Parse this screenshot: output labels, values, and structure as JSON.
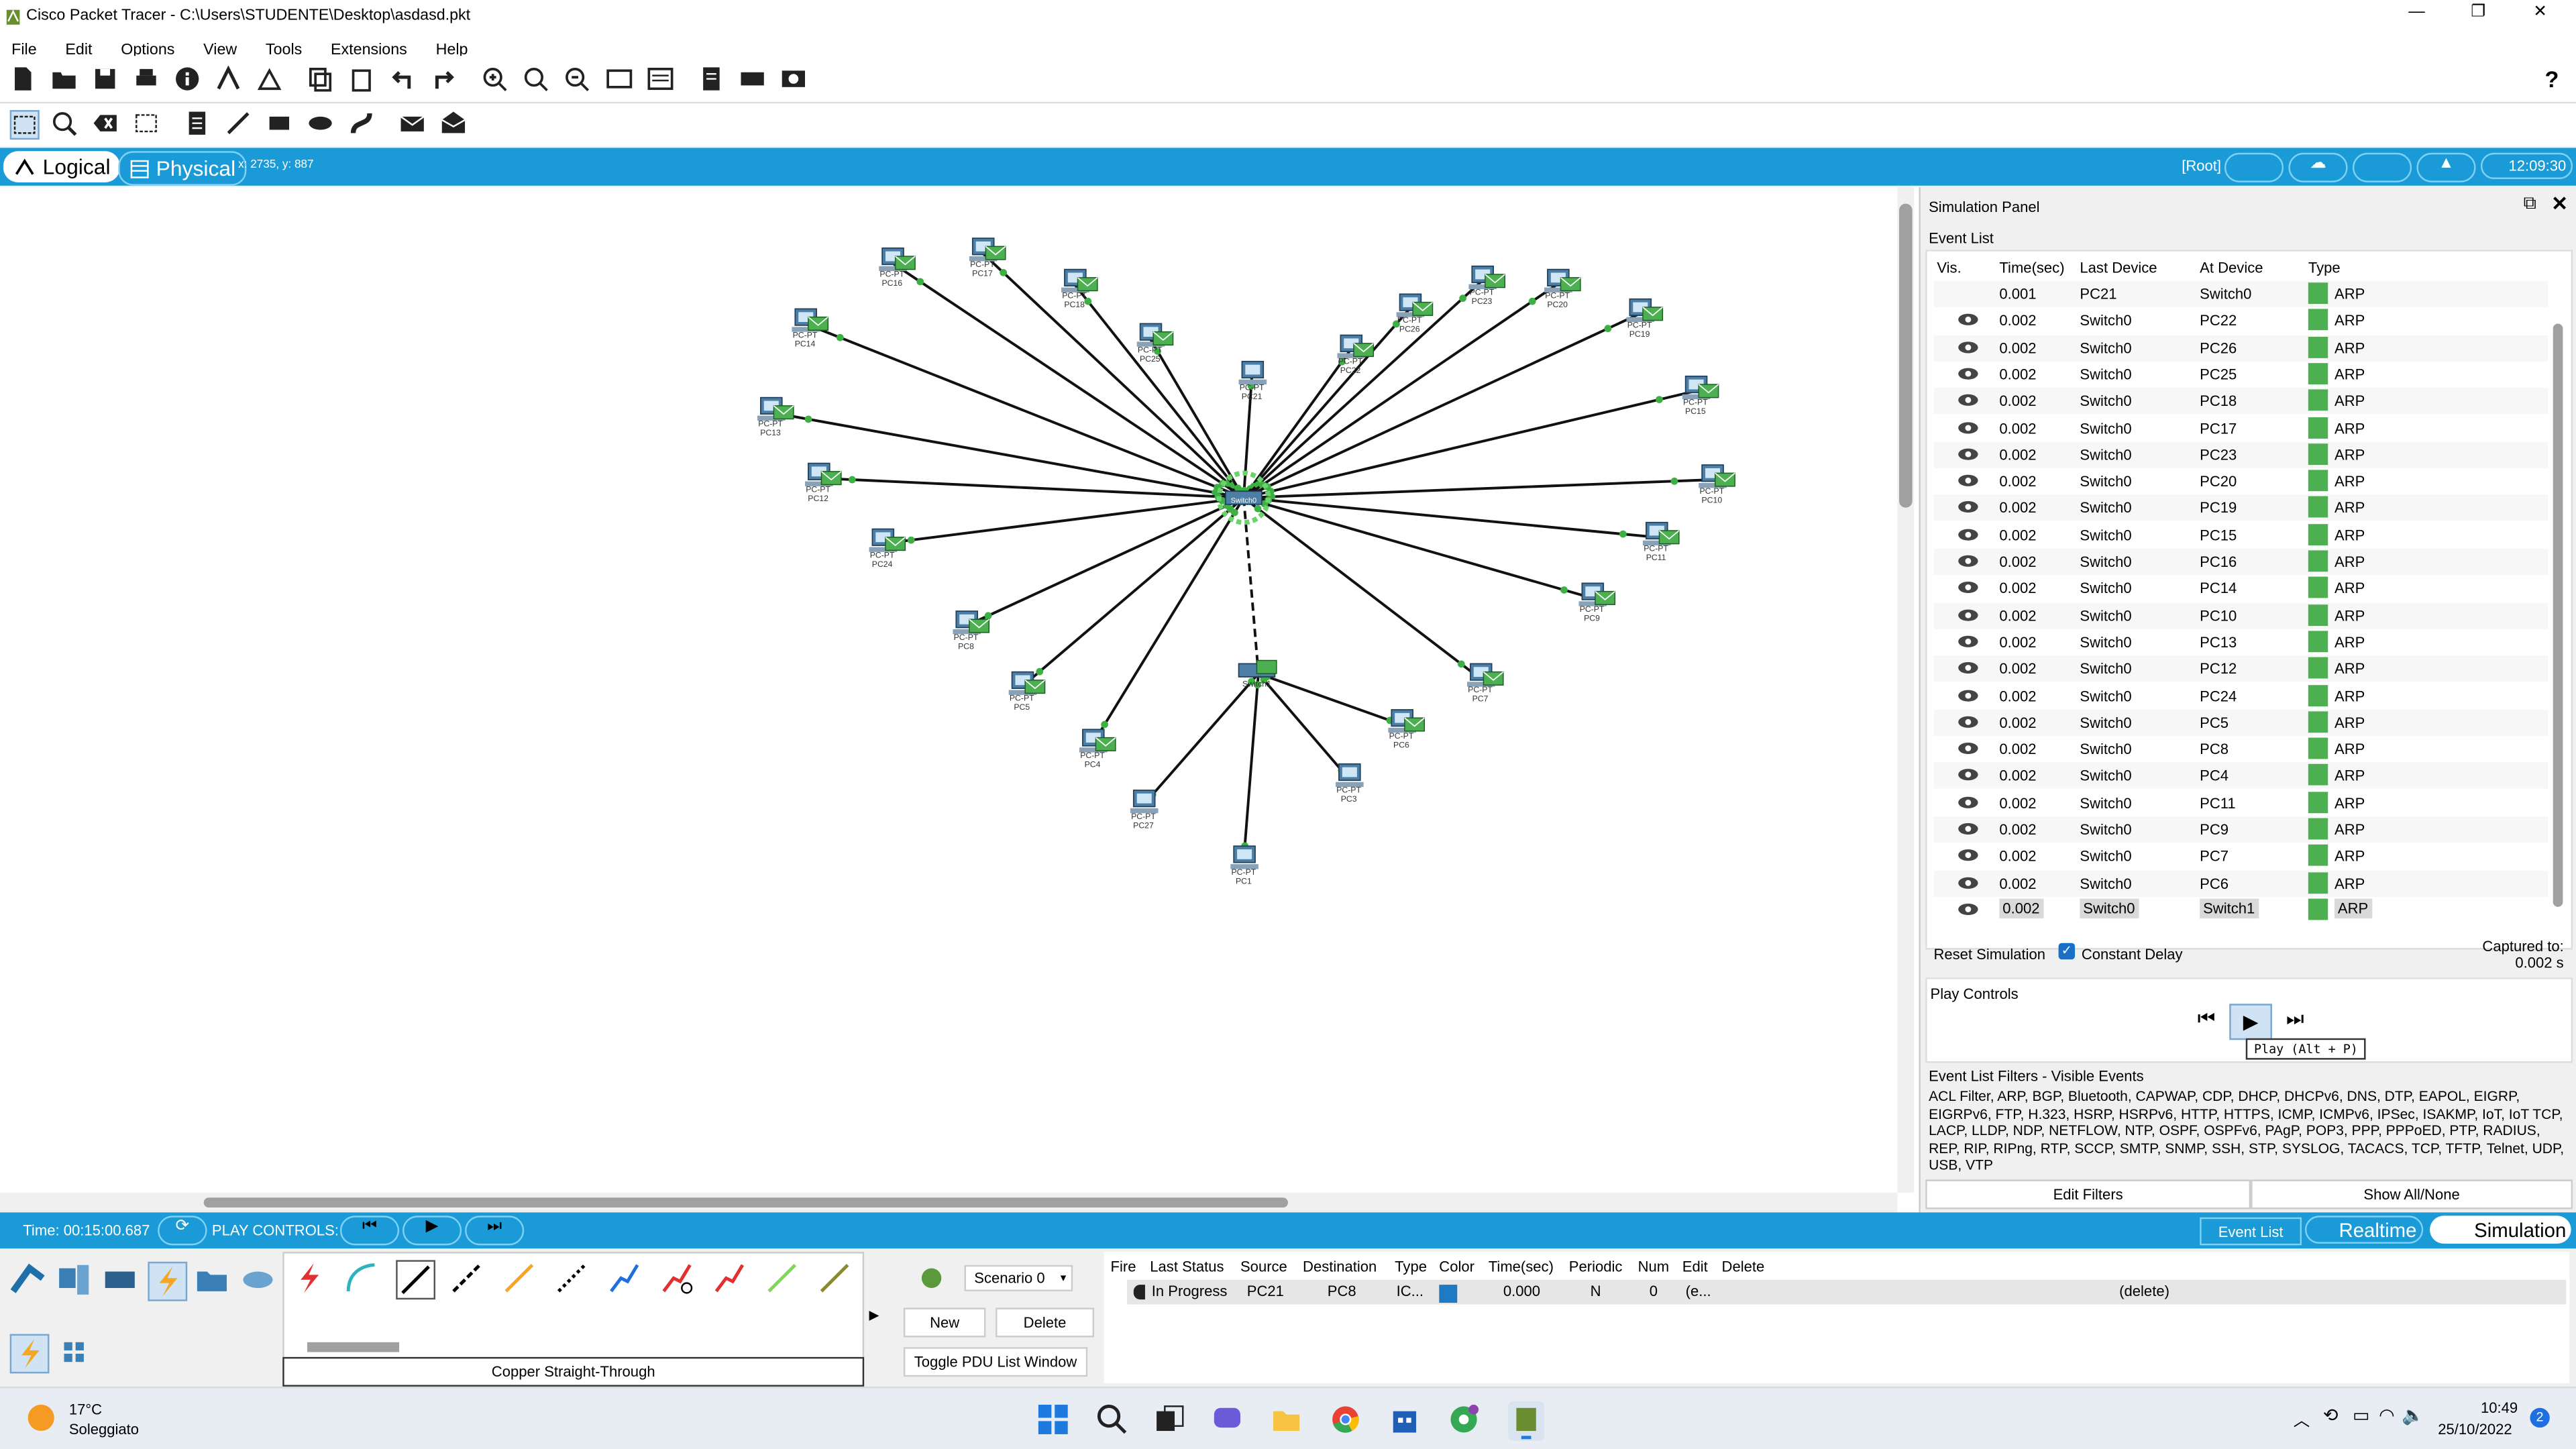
{
  "window": {
    "title": "Cisco Packet Tracer - C:\\Users\\STUDENTE\\Desktop\\asdasd.pkt",
    "controls": [
      "—",
      "❐",
      "✕"
    ]
  },
  "menu": [
    "File",
    "Edit",
    "Options",
    "View",
    "Tools",
    "Extensions",
    "Help"
  ],
  "help_icon": "?",
  "workspace": {
    "logical_label": "Logical",
    "physical_label": "Physical",
    "coords": "x: 2735, y: 887",
    "root_label": "[Root]",
    "clock": "12:09:30"
  },
  "topology": {
    "center": "Switch0",
    "devices": [
      {
        "name": "PC16",
        "model": "PC-PT"
      },
      {
        "name": "PC17",
        "model": "PC-PT"
      },
      {
        "name": "PC18",
        "model": "PC-PT"
      },
      {
        "name": "PC14",
        "model": "PC-PT"
      },
      {
        "name": "PC25",
        "model": "PC-PT"
      },
      {
        "name": "PC21",
        "model": "PC-PT"
      },
      {
        "name": "PC22",
        "model": "PC-PT"
      },
      {
        "name": "PC26",
        "model": "PC-PT"
      },
      {
        "name": "PC23",
        "model": "PC-PT"
      },
      {
        "name": "PC20",
        "model": "PC-PT"
      },
      {
        "name": "PC19",
        "model": "PC-PT"
      },
      {
        "name": "PC13",
        "model": "PC-PT"
      },
      {
        "name": "PC15",
        "model": "PC-PT"
      },
      {
        "name": "PC12",
        "model": "PC-PT"
      },
      {
        "name": "PC10",
        "model": "PC-PT"
      },
      {
        "name": "PC24",
        "model": "PC-PT"
      },
      {
        "name": "PC11",
        "model": "PC-PT"
      },
      {
        "name": "PC9",
        "model": "PC-PT"
      },
      {
        "name": "PC8",
        "model": "PC-PT"
      },
      {
        "name": "PC5",
        "model": "PC-PT"
      },
      {
        "name": "PC7",
        "model": "PC-PT"
      },
      {
        "name": "Switch1",
        "model": ""
      },
      {
        "name": "PC6",
        "model": "PC-PT"
      },
      {
        "name": "PC4",
        "model": "PC-PT"
      },
      {
        "name": "PC3",
        "model": "PC-PT"
      },
      {
        "name": "PC27",
        "model": "PC-PT"
      },
      {
        "name": "PC1",
        "model": "PC-PT"
      }
    ]
  },
  "sim_panel": {
    "title": "Simulation Panel",
    "event_list_label": "Event List",
    "headers": [
      "Vis.",
      "Time(sec)",
      "Last Device",
      "At Device",
      "Type"
    ],
    "events": [
      {
        "time": "0.001",
        "last": "PC21",
        "at": "Switch0",
        "type": "ARP",
        "vis": false
      },
      {
        "time": "0.002",
        "last": "Switch0",
        "at": "PC22",
        "type": "ARP",
        "vis": true
      },
      {
        "time": "0.002",
        "last": "Switch0",
        "at": "PC26",
        "type": "ARP",
        "vis": true
      },
      {
        "time": "0.002",
        "last": "Switch0",
        "at": "PC25",
        "type": "ARP",
        "vis": true
      },
      {
        "time": "0.002",
        "last": "Switch0",
        "at": "PC18",
        "type": "ARP",
        "vis": true
      },
      {
        "time": "0.002",
        "last": "Switch0",
        "at": "PC17",
        "type": "ARP",
        "vis": true
      },
      {
        "time": "0.002",
        "last": "Switch0",
        "at": "PC23",
        "type": "ARP",
        "vis": true
      },
      {
        "time": "0.002",
        "last": "Switch0",
        "at": "PC20",
        "type": "ARP",
        "vis": true
      },
      {
        "time": "0.002",
        "last": "Switch0",
        "at": "PC19",
        "type": "ARP",
        "vis": true
      },
      {
        "time": "0.002",
        "last": "Switch0",
        "at": "PC15",
        "type": "ARP",
        "vis": true
      },
      {
        "time": "0.002",
        "last": "Switch0",
        "at": "PC16",
        "type": "ARP",
        "vis": true
      },
      {
        "time": "0.002",
        "last": "Switch0",
        "at": "PC14",
        "type": "ARP",
        "vis": true
      },
      {
        "time": "0.002",
        "last": "Switch0",
        "at": "PC10",
        "type": "ARP",
        "vis": true
      },
      {
        "time": "0.002",
        "last": "Switch0",
        "at": "PC13",
        "type": "ARP",
        "vis": true
      },
      {
        "time": "0.002",
        "last": "Switch0",
        "at": "PC12",
        "type": "ARP",
        "vis": true
      },
      {
        "time": "0.002",
        "last": "Switch0",
        "at": "PC24",
        "type": "ARP",
        "vis": true
      },
      {
        "time": "0.002",
        "last": "Switch0",
        "at": "PC5",
        "type": "ARP",
        "vis": true
      },
      {
        "time": "0.002",
        "last": "Switch0",
        "at": "PC8",
        "type": "ARP",
        "vis": true
      },
      {
        "time": "0.002",
        "last": "Switch0",
        "at": "PC4",
        "type": "ARP",
        "vis": true
      },
      {
        "time": "0.002",
        "last": "Switch0",
        "at": "PC11",
        "type": "ARP",
        "vis": true
      },
      {
        "time": "0.002",
        "last": "Switch0",
        "at": "PC9",
        "type": "ARP",
        "vis": true
      },
      {
        "time": "0.002",
        "last": "Switch0",
        "at": "PC7",
        "type": "ARP",
        "vis": true
      },
      {
        "time": "0.002",
        "last": "Switch0",
        "at": "PC6",
        "type": "ARP",
        "vis": true
      },
      {
        "time": "0.002",
        "last": "Switch0",
        "at": "Switch1",
        "type": "ARP",
        "vis": true,
        "selected": true
      }
    ],
    "reset_label": "Reset Simulation",
    "constant_delay_label": "Constant Delay",
    "captured_label": "Captured to:",
    "captured_value": "0.002 s",
    "play_controls_label": "Play Controls",
    "tooltip": "Play (Alt + P)",
    "filters_label": "Event List Filters - Visible Events",
    "filters_text": "ACL Filter, ARP, BGP, Bluetooth, CAPWAP, CDP, DHCP, DHCPv6, DNS, DTP, EAPOL, EIGRP, EIGRPv6, FTP, H.323, HSRP, HSRPv6, HTTP, HTTPS, ICMP, ICMPv6, IPSec, ISAKMP, IoT, IoT TCP, LACP, LLDP, NDP, NETFLOW, NTP, OSPF, OSPFv6, PAgP, POP3, PPP, PPPoED, PTP, RADIUS, REP, RIP, RIPng, RTP, SCCP, SMTP, SNMP, SSH, STP, SYSLOG, TACACS, TCP, TFTP, Telnet, UDP, USB, VTP",
    "edit_filters_label": "Edit Filters",
    "show_all_label": "Show All/None",
    "arp_color": "#4caf50"
  },
  "bottom_bar": {
    "time_label": "Time: 00:15:00.687",
    "play_controls_label": "PLAY CONTROLS:",
    "event_list_btn": "Event List",
    "realtime_label": "Realtime",
    "simulation_label": "Simulation"
  },
  "device_panel": {
    "cable_label": "Copper Straight-Through"
  },
  "scenario": {
    "selected": "Scenario 0",
    "new_label": "New",
    "delete_label": "Delete",
    "toggle_label": "Toggle PDU List Window"
  },
  "pdu_list": {
    "headers": [
      "Fire",
      "Last Status",
      "Source",
      "Destination",
      "Type",
      "Color",
      "Time(sec)",
      "Periodic",
      "Num",
      "Edit",
      "Delete"
    ],
    "rows": [
      {
        "status": "In Progress",
        "source": "PC21",
        "destination": "PC8",
        "type": "IC...",
        "time": "0.000",
        "periodic": "N",
        "num": "0",
        "edit": "(e...",
        "delete": "(delete)"
      }
    ]
  },
  "taskbar": {
    "temperature": "17°C",
    "weather": "Soleggiato",
    "time": "10:49",
    "date": "25/10/2022",
    "notif_count": "2"
  }
}
